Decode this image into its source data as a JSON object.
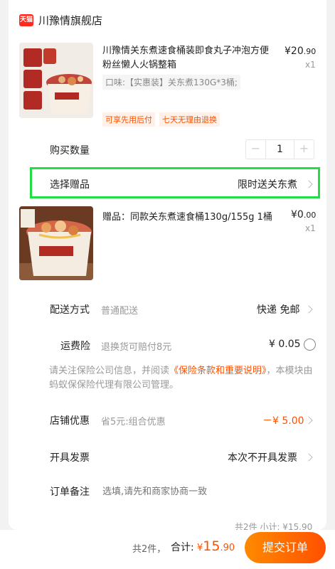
{
  "store": {
    "logo_text": "天猫",
    "name": "川豫情旗舰店"
  },
  "product": {
    "title": "川豫情关东煮速食桶装即食丸子冲泡方便粉丝懒人火锅整箱",
    "price_symbol": "¥",
    "price_int": "20",
    "price_dec": ".90",
    "qty": "x1",
    "variant": "口味:【实惠装】关东煮130G*3桶;",
    "tags": [
      "可享先用后付",
      "七天无理由退换"
    ]
  },
  "purchase_qty": {
    "label": "购买数量",
    "minus": "−",
    "value": "1",
    "plus": "+"
  },
  "gift_select": {
    "label": "选择赠品",
    "value": "限时送关东煮"
  },
  "gift": {
    "title": "赠品：同款关东煮速食桶130g/155g  1桶",
    "price_symbol": "¥",
    "price_int": "0",
    "price_dec": ".00",
    "qty": "x1"
  },
  "delivery": {
    "label": "配送方式",
    "hint": "普通配送",
    "value": "快递 免邮"
  },
  "shipping_insurance": {
    "label": "运费险",
    "hint": "退换货可赔付8元",
    "value": "¥ 0.05"
  },
  "notice": {
    "text_before": "请关注保险公司信息，并阅读",
    "link": "《保险条款和重要说明》",
    "text_after": "，本模块由蚂蚁保保险代理有限公司管理。"
  },
  "store_discount": {
    "label": "店铺优惠",
    "hint": "省5元:组合优惠",
    "value": "－¥ 5.00"
  },
  "invoice": {
    "label": "开具发票",
    "value": "本次不开具发票"
  },
  "order_note": {
    "label": "订单备注",
    "placeholder": "选填,请先和商家协商一致"
  },
  "subtotal_partial": "共2件 小计: ¥15.90",
  "footer": {
    "count": "共2件，",
    "total_label": "合计:",
    "total_symbol": "¥",
    "total_int": "15",
    "total_dec": ".90",
    "submit": "提交订单"
  },
  "colors": {
    "accent": "#ff5000",
    "highlight": "#22dd44"
  }
}
